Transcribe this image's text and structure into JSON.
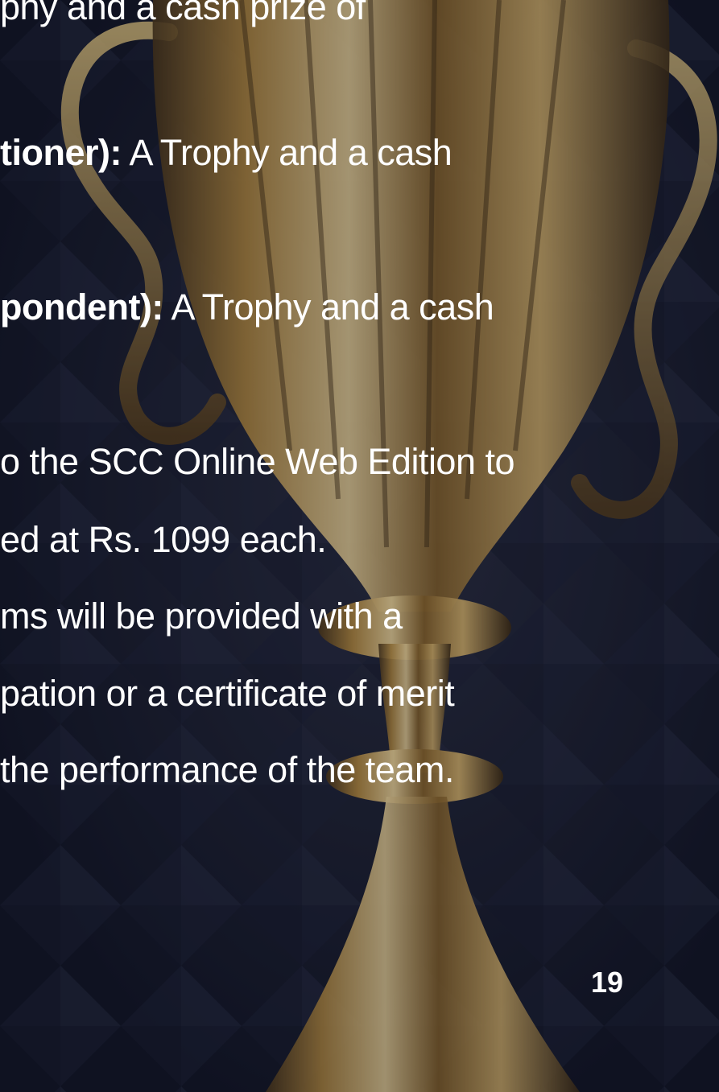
{
  "document": {
    "lines": [
      {
        "text": "phy and a cash prize of"
      },
      {
        "bold": "tioner):",
        "text": " A Trophy and a cash"
      },
      {
        "bold": "pondent):",
        "text": " A Trophy and a cash"
      },
      {
        "text": "o the SCC Online Web Edition to"
      },
      {
        "text": "ed at Rs. 1099 each."
      },
      {
        "text": "ms will be provided with a"
      },
      {
        "text": "pation or a certificate of merit"
      },
      {
        "text": "the performance of the team."
      }
    ],
    "page_number": "19"
  },
  "colors": {
    "background": "#14172a",
    "trophy_gold": "#c9a24a",
    "text": "#ffffff"
  },
  "images": [
    "gold-trophy-cup",
    "dark-diamond-pattern-background"
  ]
}
